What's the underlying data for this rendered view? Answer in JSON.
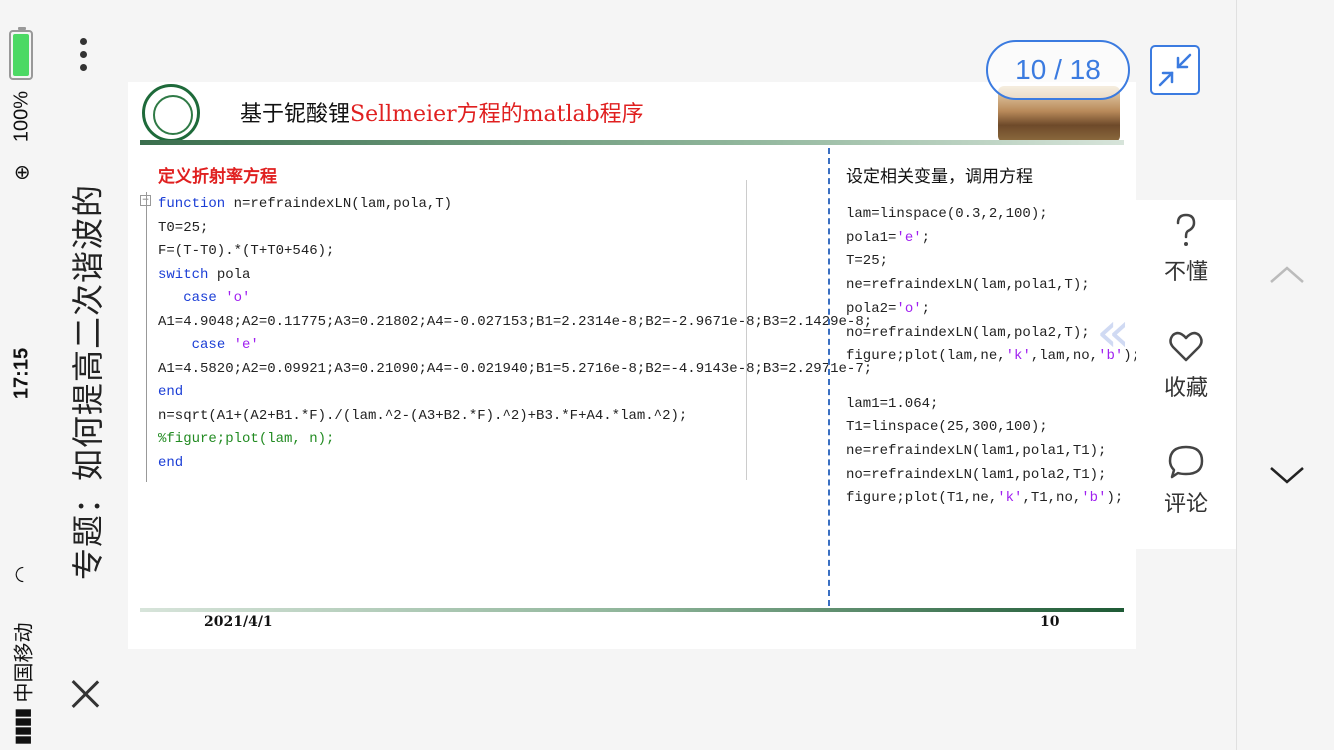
{
  "status_bar": {
    "time": "17:15",
    "battery": "100%",
    "carrier": "中国移动",
    "battery_level": 1.0
  },
  "nav": {
    "title": "专题：如何提高二次谐波的"
  },
  "slide": {
    "title_black": "基于铌酸锂",
    "title_red": "Sellmeier方程的matlab程序",
    "left_heading": "定义折射率方程",
    "right_heading": "设定相关变量，调用方程",
    "left_code": [
      {
        "kw": "function",
        "rest": " n=refraindexLN(lam,pola,T)"
      },
      {
        "text": "T0=25;"
      },
      {
        "text": "F=(T-T0).*(T+T0+546);"
      },
      {
        "kw": "switch",
        "rest": " pola"
      },
      {
        "indent": "   ",
        "kw": "case",
        "str": " 'o'"
      },
      {
        "text": "A1=4.9048;A2=0.11775;A3=0.21802;A4=-0.027153;B1=2.2314e-8;B2=-2.9671e-8;B3=2.1429e-8;"
      },
      {
        "indent": "    ",
        "kw": "case",
        "str": " 'e'"
      },
      {
        "text": "A1=4.5820;A2=0.09921;A3=0.21090;A4=-0.021940;B1=5.2716e-8;B2=-4.9143e-8;B3=2.2971e-7;"
      },
      {
        "kw": "end",
        "rest": ""
      },
      {
        "text": "n=sqrt(A1+(A2+B1.*F)./(lam.^2-(A3+B2.*F).^2)+B3.*F+A4.*lam.^2);"
      },
      {
        "cmt": "%figure;plot(lam, n);"
      },
      {
        "kw": "end",
        "rest": ""
      }
    ],
    "right_code_1": [
      {
        "a": "lam=linspace(0.3,2,100);"
      },
      {
        "a": "pola1=",
        "s": "'e'",
        "b": ";"
      },
      {
        "a": "T=25;"
      },
      {
        "a": "ne=refraindexLN(lam,pola1,T);"
      },
      {
        "a": "pola2=",
        "s": "'o'",
        "b": ";"
      },
      {
        "a": "no=refraindexLN(lam,pola2,T);"
      },
      {
        "a": "figure;plot(lam,ne,",
        "s": "'k'",
        "b": ",lam,no,",
        "s2": "'b'",
        "c": ");"
      }
    ],
    "right_code_2": [
      {
        "a": "lam1=1.064;"
      },
      {
        "a": "T1=linspace(25,300,100);"
      },
      {
        "a": "ne=refraindexLN(lam1,pola1,T1);"
      },
      {
        "a": "no=refraindexLN(lam1,pola2,T1);"
      },
      {
        "a": "figure;plot(T1,ne,",
        "s": "'k'",
        "b": ",T1,no,",
        "s2": "'b'",
        "c": ");"
      }
    ],
    "footer_date": "2021/4/1",
    "footer_page": "10"
  },
  "viewer": {
    "page_counter": "10 / 18",
    "actions": {
      "not_understand": "不懂",
      "favorite": "收藏",
      "comment": "评论"
    }
  },
  "colors": {
    "accent": "#3b7be0",
    "title_red": "#e02020",
    "keyword_blue": "#1a3dd6",
    "string_purple": "#a020f0",
    "comment_green": "#228b22"
  },
  "icons": {
    "close": "close-icon",
    "more": "more-dots-icon",
    "collapse": "collapse-arrows-icon",
    "question": "question-icon",
    "heart": "heart-icon",
    "comment": "comment-bubble-icon",
    "up": "chevron-up-icon",
    "down": "chevron-down-icon"
  }
}
